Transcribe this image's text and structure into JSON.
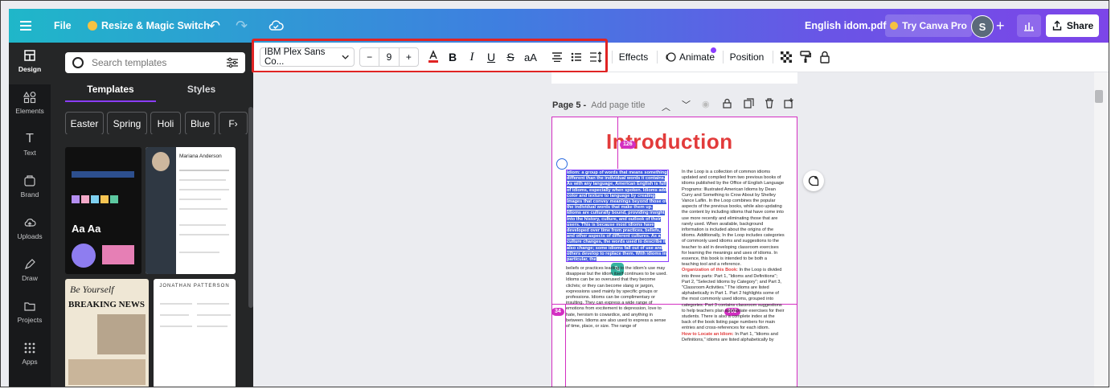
{
  "topbar": {
    "file_label": "File",
    "resize_label": "Resize & Magic Switch",
    "doc_title": "English idom.pdf",
    "try_pro_label": "Try Canva Pro",
    "avatar_initial": "S",
    "share_label": "Share"
  },
  "rail": {
    "items": [
      {
        "label": "Design",
        "icon": "layout-icon"
      },
      {
        "label": "Elements",
        "icon": "shapes-icon"
      },
      {
        "label": "Text",
        "icon": "text-icon"
      },
      {
        "label": "Brand",
        "icon": "brand-icon"
      },
      {
        "label": "Uploads",
        "icon": "cloud-upload-icon"
      },
      {
        "label": "Draw",
        "icon": "pen-icon"
      },
      {
        "label": "Projects",
        "icon": "folder-icon"
      },
      {
        "label": "Apps",
        "icon": "apps-grid-icon"
      }
    ]
  },
  "panel": {
    "search_placeholder": "Search templates",
    "tabs": [
      "Templates",
      "Styles"
    ],
    "chips": [
      "Easter",
      "Spring",
      "Holi",
      "Blue",
      "F›"
    ],
    "thumb_texts": {
      "resume_name": "Mariana Anderson",
      "news_title1": "Be Yourself",
      "news_title2": "BREAKING NEWS",
      "resume2_name": "JONATHAN PATTERSON"
    }
  },
  "toolbar": {
    "font": "IBM Plex Sans Co...",
    "minus": "−",
    "size": "9",
    "plus": "+",
    "effects": "Effects",
    "animate": "Animate",
    "position": "Position",
    "accent_color": "#e02424"
  },
  "page": {
    "header_label": "Page 5 -",
    "add_title": "Add page title",
    "heading": "Introduction",
    "badge_top": "126",
    "badge_left": "34",
    "badge_mid": "302",
    "left_col_highlight": "Idiom: a group of words that means something different than the individual words it contains. As with any language, American English is full of idioms, especially when spoken. Idioms add color and texture to language by creating images that convey meanings beyond those of the individual words that make them up. Idioms are culturally bound, providing insight into the history, culture, and outlook of their users. This is because most idioms have developed over time from practices, beliefs, and other aspects of different cultures. As a culture changes, the words used to describe it also change; some idioms fall out of use and others develop to replace them. With idioms in particular, the",
    "left_col_rest": "beliefs or practices leading to the idiom's use may disappear but the idiom itself continues to be used. Idioms can be so overused that they become clichés; or they can become slang or jargon, expressions used mainly by specific groups or professions. Idioms can be complimentary or insulting. They can express a wide range of emotions from excitement to depression, love to hate, heroism to cowardice, and anything in between. Idioms are also used to express a sense of time, place, or size. The range of",
    "right_col_1": "In the Loop is a collection of common idioms updated and compiled from two previous books of idioms published by the Office of English Language Programs: Illustrated American Idioms by Dean Curry and Something to Crow About by Shelley Vance Laflin. In the Loop combines the popular aspects of the previous books, while also updating the content by including idioms that have come into use more recently and eliminating those that are rarely used. When available, background information is included about the origins of the idioms. Additionally, In the Loop includes categories of commonly used idioms and suggestions to the teacher to aid in developing classroom exercises for learning the meanings and uses of idioms. In essence, this book is intended to be both a teaching tool and a reference.",
    "right_col_h1": "Organization of this Book:",
    "right_col_2": "In the Loop is divided into three parts: Part 1, \"Idioms and Definitions\"; Part 2, \"Selected Idioms by Category\"; and Part 3, \"Classroom Activities.\" The idioms are listed alphabetically in Part 1. Part 2 highlights some of the most commonly used idioms, grouped into categories. Part 3 contains classroom suggestions to help teachers plan appropriate exercises for their students. There is also a complete index at the back of the book listing page numbers for main entries and cross-references for each idiom.",
    "right_col_h2": "How to Locate an Idiom:",
    "right_col_3": "In Part 1, \"Idioms and Definitions,\" idioms are listed alphabetically by"
  }
}
